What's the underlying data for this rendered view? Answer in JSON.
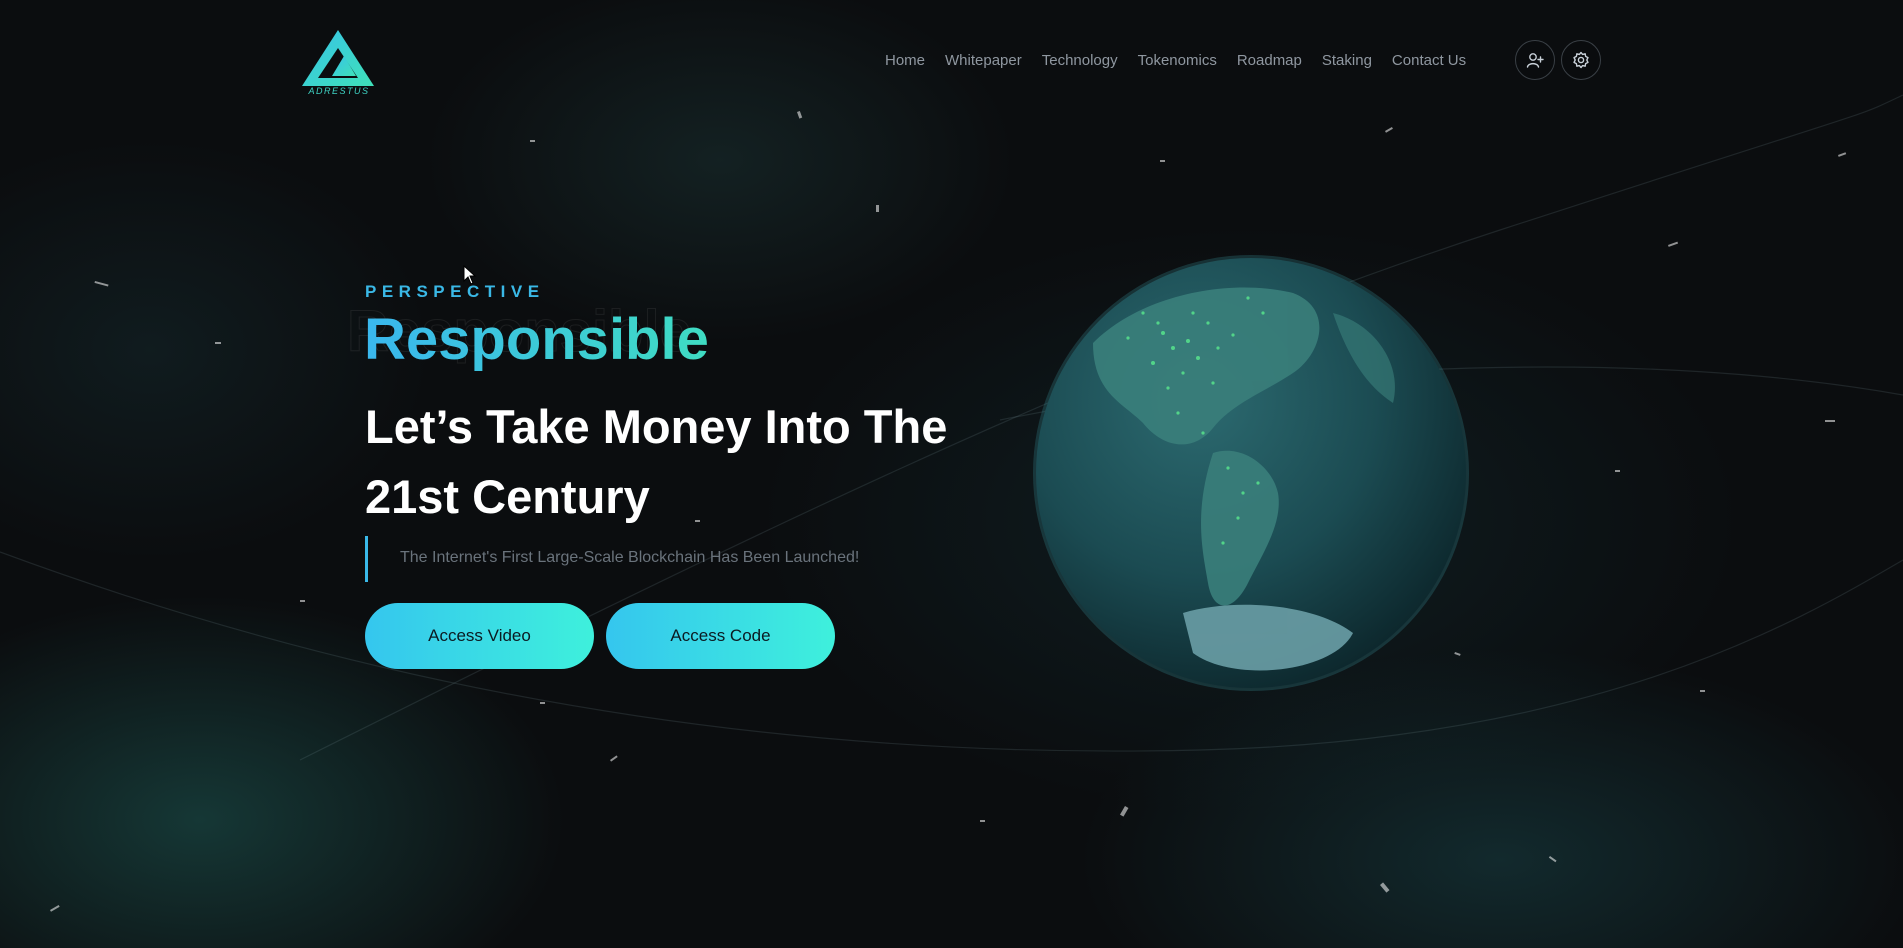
{
  "brand": {
    "logo_text": "ADRESTUS",
    "accent": "#3fd3c4",
    "accent_blue": "#3ab8e6"
  },
  "nav": {
    "items": [
      {
        "label": "Home"
      },
      {
        "label": "Whitepaper"
      },
      {
        "label": "Technology"
      },
      {
        "label": "Tokenomics"
      },
      {
        "label": "Roadmap"
      },
      {
        "label": "Staking"
      },
      {
        "label": "Contact Us"
      }
    ],
    "icons": {
      "register": "add-user-icon",
      "settings": "gear-icon"
    }
  },
  "hero": {
    "kicker": "PERSPECTIVE",
    "headline": "Responsible",
    "title": "Let’s Take Money Into The 21st Century",
    "subtitle": "The Internet's First Large-Scale Blockchain Has Been Launched!",
    "buttons": {
      "video": "Access Video",
      "code": "Access Code"
    }
  },
  "background": {
    "visual": "globe-image"
  }
}
